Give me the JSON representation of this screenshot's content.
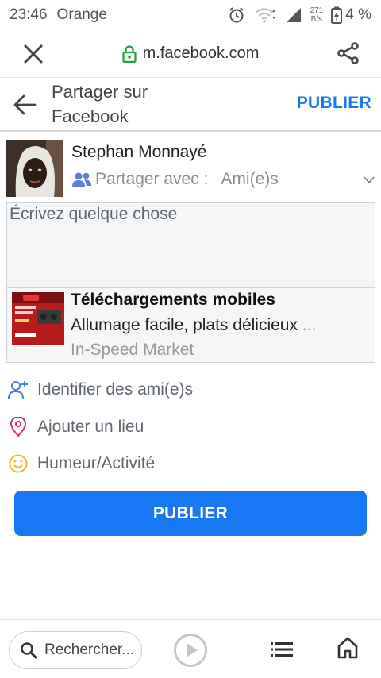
{
  "status_bar": {
    "time": "23:46",
    "carrier": "Orange",
    "net_speed_value": "271",
    "net_speed_unit": "B/s",
    "battery": "4 %"
  },
  "browser": {
    "url": "m.facebook.com"
  },
  "header": {
    "title_line1": "Partager sur",
    "title_line2": "Facebook",
    "publish_label": "PUBLIER"
  },
  "user": {
    "name": "Stephan Monnayé",
    "share_with_label": "Partager avec :",
    "audience": "Ami(e)s"
  },
  "composer": {
    "placeholder": "Écrivez quelque chose"
  },
  "link_preview": {
    "title": "Téléchargements mobiles",
    "description": "Allumage facile, plats délicieux",
    "ellipsis": "...",
    "source": "In-Speed Market"
  },
  "actions": [
    {
      "label": "Identifier des ami(e)s",
      "icon": "add-person-icon"
    },
    {
      "label": "Ajouter un lieu",
      "icon": "location-pin-icon"
    },
    {
      "label": "Humeur/Activité",
      "icon": "smiley-icon"
    }
  ],
  "publish_button": {
    "label": "PUBLIER"
  },
  "bottom_nav": {
    "search_label": "Rechercher..."
  },
  "colors": {
    "brand_blue": "#1877f2",
    "pin_pink": "#d12e6b",
    "smiley_yellow": "#f3b71d"
  }
}
